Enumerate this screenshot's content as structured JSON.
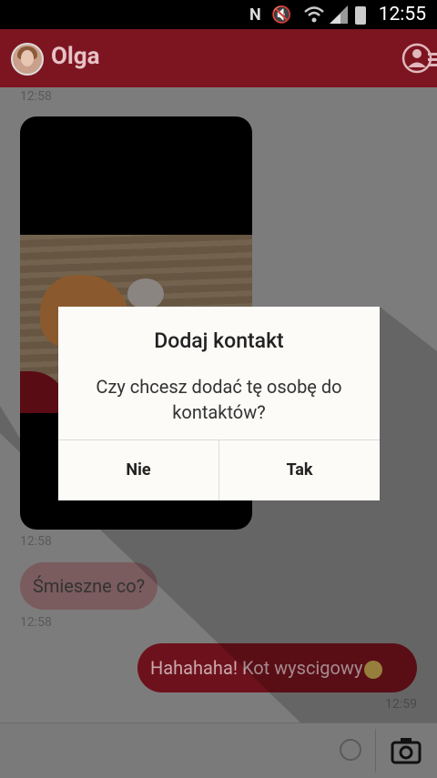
{
  "status_bar": {
    "time": "12:55",
    "icons": [
      "n-icon",
      "mute-icon",
      "wifi-icon",
      "signal-icon",
      "battery-icon"
    ]
  },
  "header": {
    "contact_name": "Olga"
  },
  "messages": {
    "ts1": "12:58",
    "ts2": "12:58",
    "ts3": "12:58",
    "ts4": "12:59",
    "incoming_text": "Śmieszne co?",
    "outgoing_text": "Hahahaha!  Kot wyscigowy"
  },
  "dialog": {
    "title": "Dodaj kontakt",
    "message": "Czy chcesz dodać tę osobę do kontaktów?",
    "no_label": "Nie",
    "yes_label": "Tak"
  },
  "colors": {
    "header": "#7d1521",
    "dialog_bg": "#fcfbf8",
    "overlay": "#7a7a7a"
  }
}
